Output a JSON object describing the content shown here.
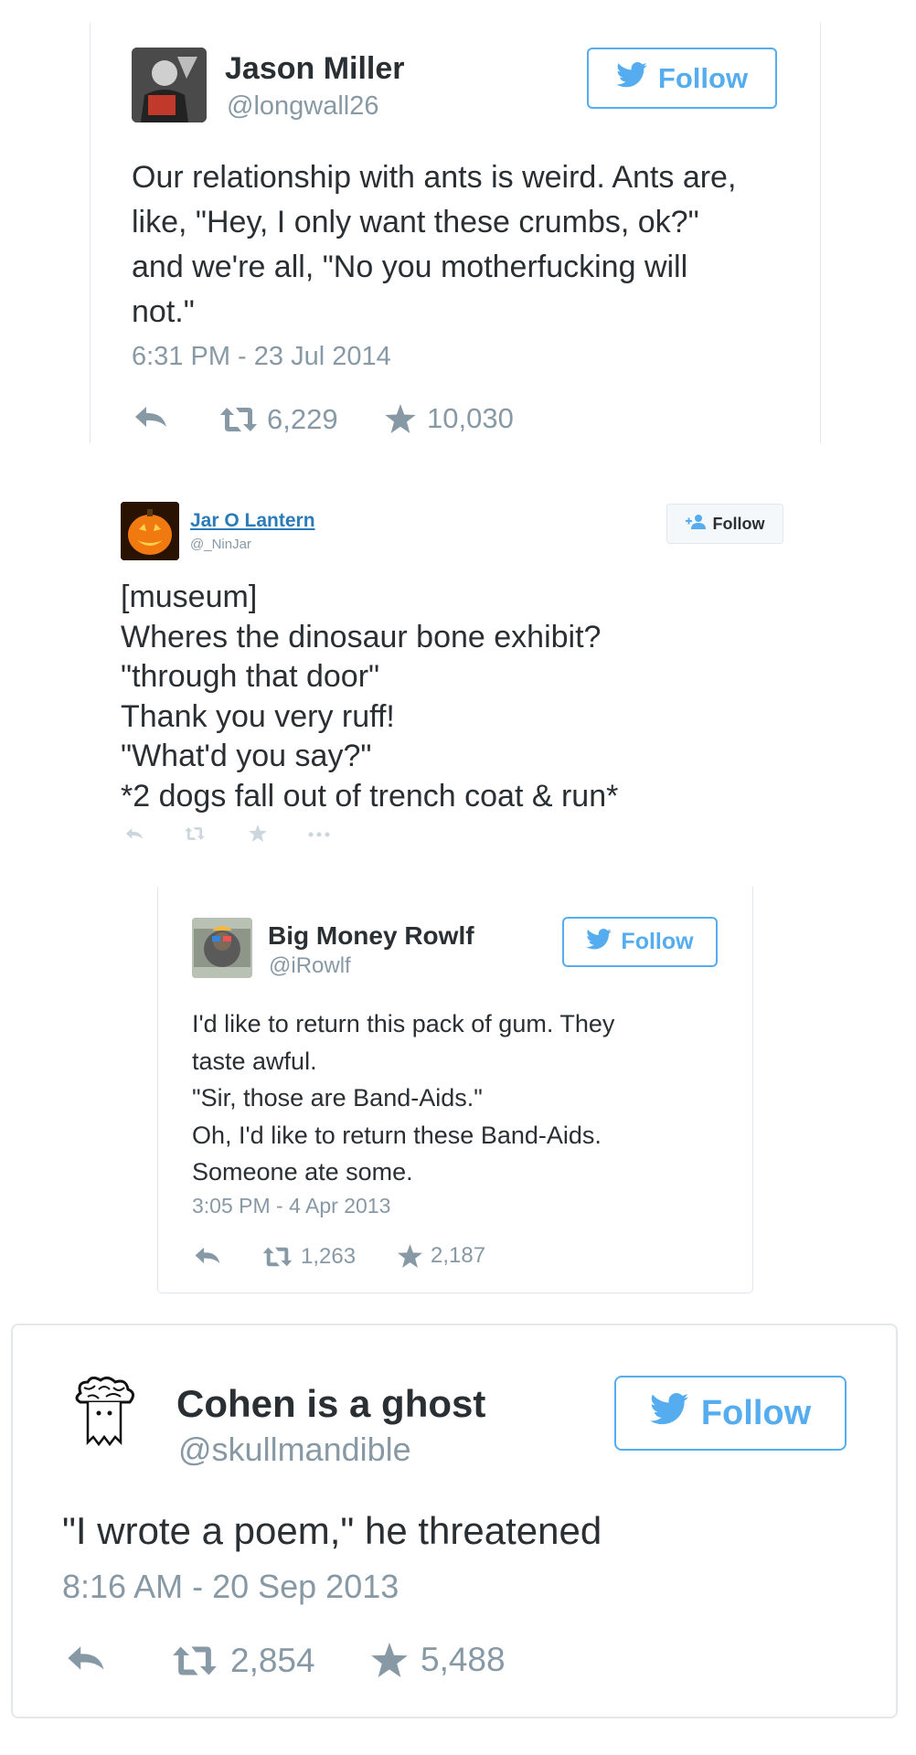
{
  "tweets": [
    {
      "name": "Jason Miller",
      "handle": "@longwall26",
      "follow_label": "Follow",
      "text_lines": [
        "Our relationship with ants is weird. Ants are,",
        "like, \"Hey, I only want these crumbs, ok?\"",
        "and we're all, \"No you motherfucking will",
        "not.\""
      ],
      "timestamp": "6:31 PM - 23 Jul 2014",
      "retweets": "6,229",
      "favorites": "10,030"
    },
    {
      "name": "Jar O Lantern",
      "handle": "@_NinJar",
      "follow_label": "Follow",
      "text_lines": [
        "[museum]",
        "Wheres the dinosaur bone exhibit?",
        "\"through that door\"",
        "Thank you very ruff!",
        "\"What'd you say?\"",
        "*2 dogs fall out of trench coat & run*"
      ]
    },
    {
      "name": "Big Money Rowlf",
      "handle": "@iRowlf",
      "follow_label": "Follow",
      "text_lines": [
        "I'd like to return this pack of gum. They",
        "taste awful.",
        "\"Sir, those are Band-Aids.\"",
        "Oh, I'd like to return these Band-Aids.",
        "Someone ate some."
      ],
      "timestamp": "3:05 PM - 4 Apr 2013",
      "retweets": "1,263",
      "favorites": "2,187"
    },
    {
      "name": "Cohen is a ghost",
      "handle": "@skullmandible",
      "follow_label": "Follow",
      "text_lines": [
        "\"I wrote a poem,\" he threatened"
      ],
      "timestamp": "8:16 AM - 20 Sep 2013",
      "retweets": "2,854",
      "favorites": "5,488"
    }
  ],
  "icons": {
    "reply": "reply-icon",
    "retweet": "retweet-icon",
    "favorite": "star-icon",
    "more": "more-icon",
    "bird": "twitter-bird-icon",
    "add_user": "add-user-icon"
  },
  "colors": {
    "twitter_blue": "#55acee",
    "meta_gray": "#8899a6",
    "text": "#292f33",
    "link_blue": "#2b7bb9"
  }
}
